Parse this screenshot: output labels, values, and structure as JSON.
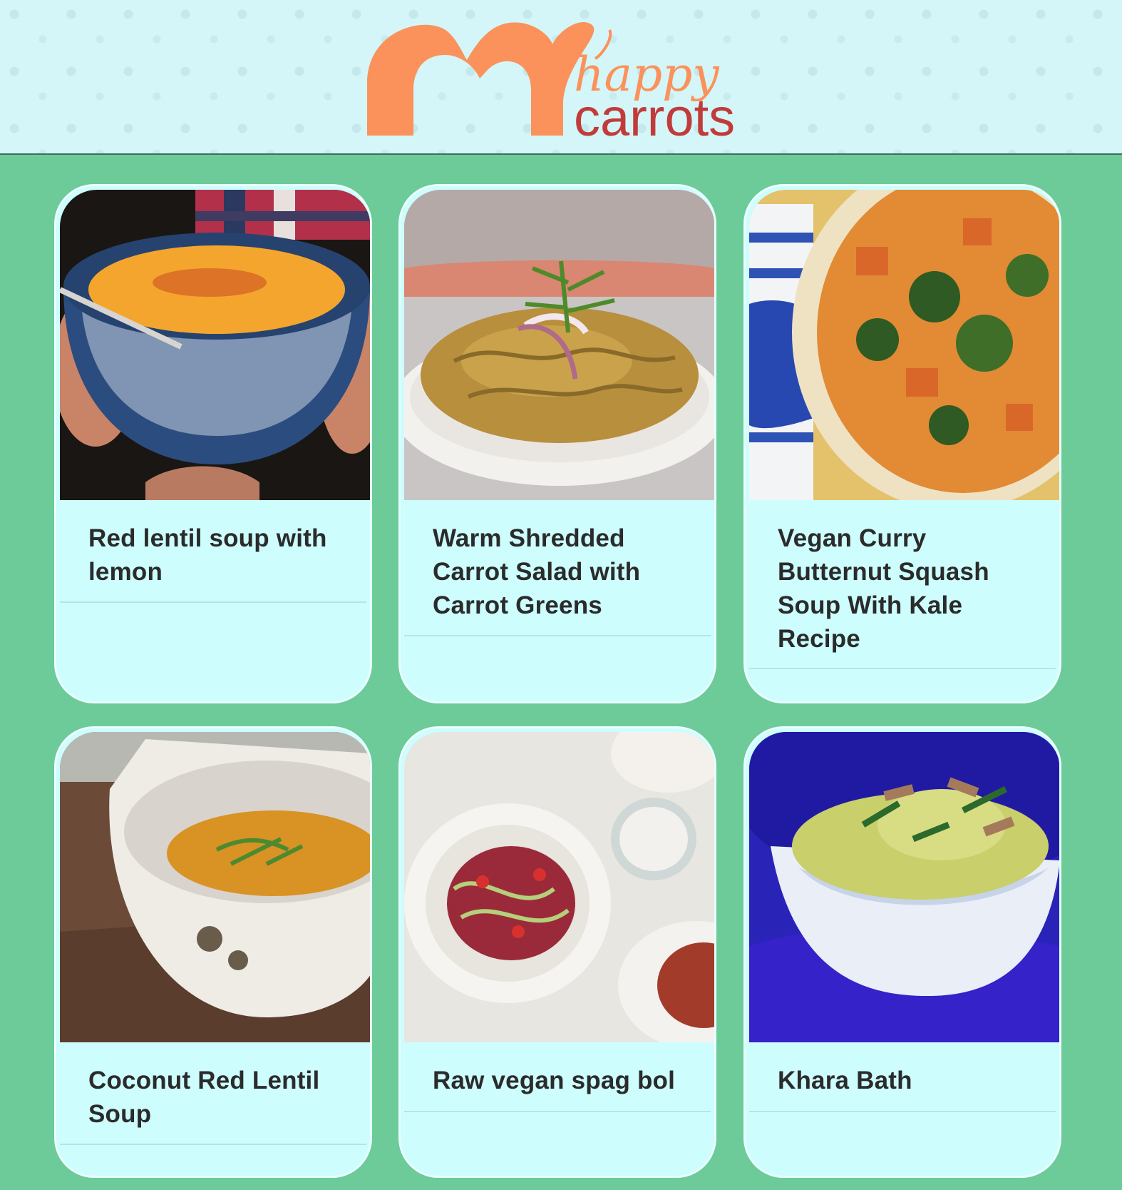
{
  "brand": {
    "script_word": "happy",
    "main_word": "carrots",
    "logo_color": "#fb925b",
    "text_color": "#c23b3b"
  },
  "colors": {
    "page_background": "#6ccb98",
    "header_background": "#d4f6f8",
    "card_background": "#cdfdfd",
    "title_text": "#2b2b2b"
  },
  "recipes": [
    {
      "title": "Red lentil soup with lemon",
      "image": "orange-soup-in-blue-floral-bowl"
    },
    {
      "title": "Warm Shredded Carrot Salad with Carrot Greens",
      "image": "shredded-carrot-salad-plate"
    },
    {
      "title": "Vegan Curry Butternut Squash Soup With Kale Recipe",
      "image": "squash-kale-stew-in-blue-pot"
    },
    {
      "title": "Coconut Red Lentil Soup",
      "image": "lentil-soup-in-white-bowl"
    },
    {
      "title": "Raw vegan spag bol",
      "image": "zucchini-noodles-bolognese"
    },
    {
      "title": "Khara Bath",
      "image": "khara-bath-in-white-bowl"
    }
  ]
}
